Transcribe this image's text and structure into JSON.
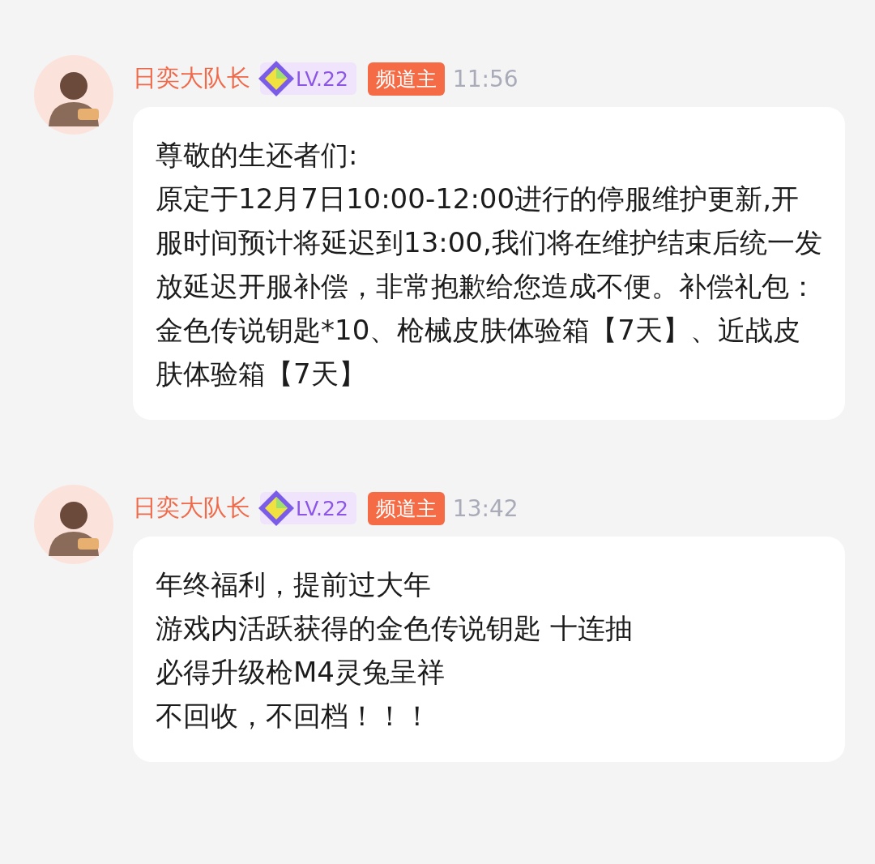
{
  "messages": [
    {
      "author": "日奕大队长",
      "level": "LV.22",
      "role": "频道主",
      "time": "11:56",
      "paragraphs": [
        "尊敬的生还者们:",
        "原定于12月7日10:00-12:00进行的停服维护更新,开服时间预计将延迟到13:00,我们将在维护结束后统一发放延迟开服补偿，非常抱歉给您造成不便。补偿礼包：金色传说钥匙*10、枪械皮肤体验箱【7天】、近战皮肤体验箱【7天】"
      ]
    },
    {
      "author": "日奕大队长",
      "level": "LV.22",
      "role": "频道主",
      "time": "13:42",
      "paragraphs": [
        "年终福利，提前过大年",
        "游戏内活跃获得的金色传说钥匙 十连抽",
        "必得升级枪M4灵兔呈祥",
        "不回收，不回档！！！"
      ]
    }
  ]
}
